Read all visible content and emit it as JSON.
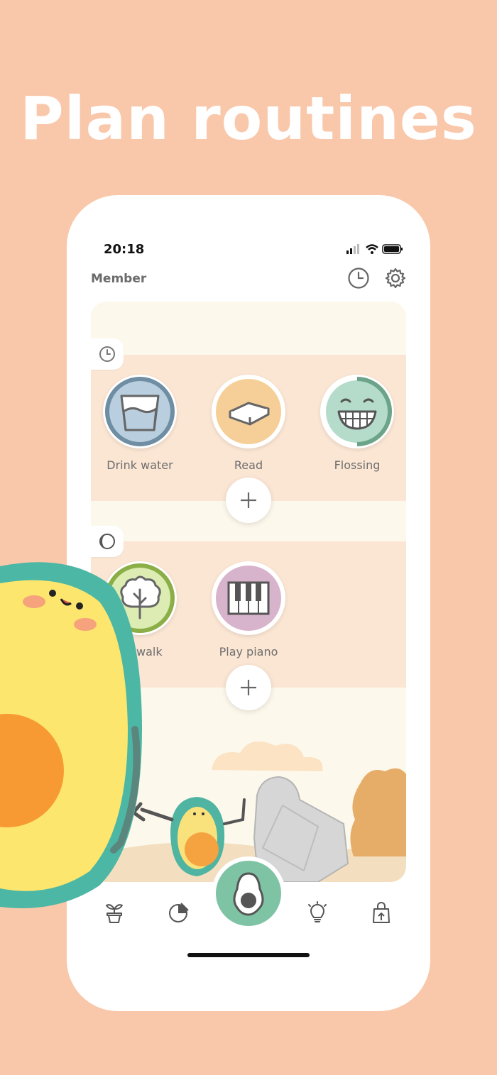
{
  "headline": "Plan routines",
  "status": {
    "time": "20:18"
  },
  "header": {
    "title": "Member",
    "history_icon": "clock-icon",
    "settings_icon": "gear-icon"
  },
  "sections": [
    {
      "icon": "clock-icon",
      "habits": [
        {
          "label": "Drink water",
          "icon": "water-glass-icon",
          "color": "#b9cfdf",
          "ring": "#6f8ea3"
        },
        {
          "label": "Read",
          "icon": "book-icon",
          "color": "#f5cf97"
        },
        {
          "label": "Flossing",
          "icon": "grin-face-icon",
          "color": "#b5dccb",
          "ring": "#6ba489"
        }
      ]
    },
    {
      "icon": "half-moon-icon",
      "habits": [
        {
          "label": "r a walk",
          "icon": "tree-icon",
          "color": "#dcecb3",
          "ring": "#8cae46"
        },
        {
          "label": "Play piano",
          "icon": "piano-icon",
          "color": "#d7b4cc"
        }
      ]
    }
  ],
  "tabbar": [
    {
      "icon": "plant-icon"
    },
    {
      "icon": "pie-chart-icon"
    },
    {
      "icon": "avocado-icon",
      "active": true,
      "color": "#7fc3a5"
    },
    {
      "icon": "lightbulb-icon"
    },
    {
      "icon": "shopping-bag-icon"
    }
  ],
  "colors": {
    "background": "#f9c8ab",
    "card": "#fdf8ec",
    "band": "#fbe6d4"
  }
}
